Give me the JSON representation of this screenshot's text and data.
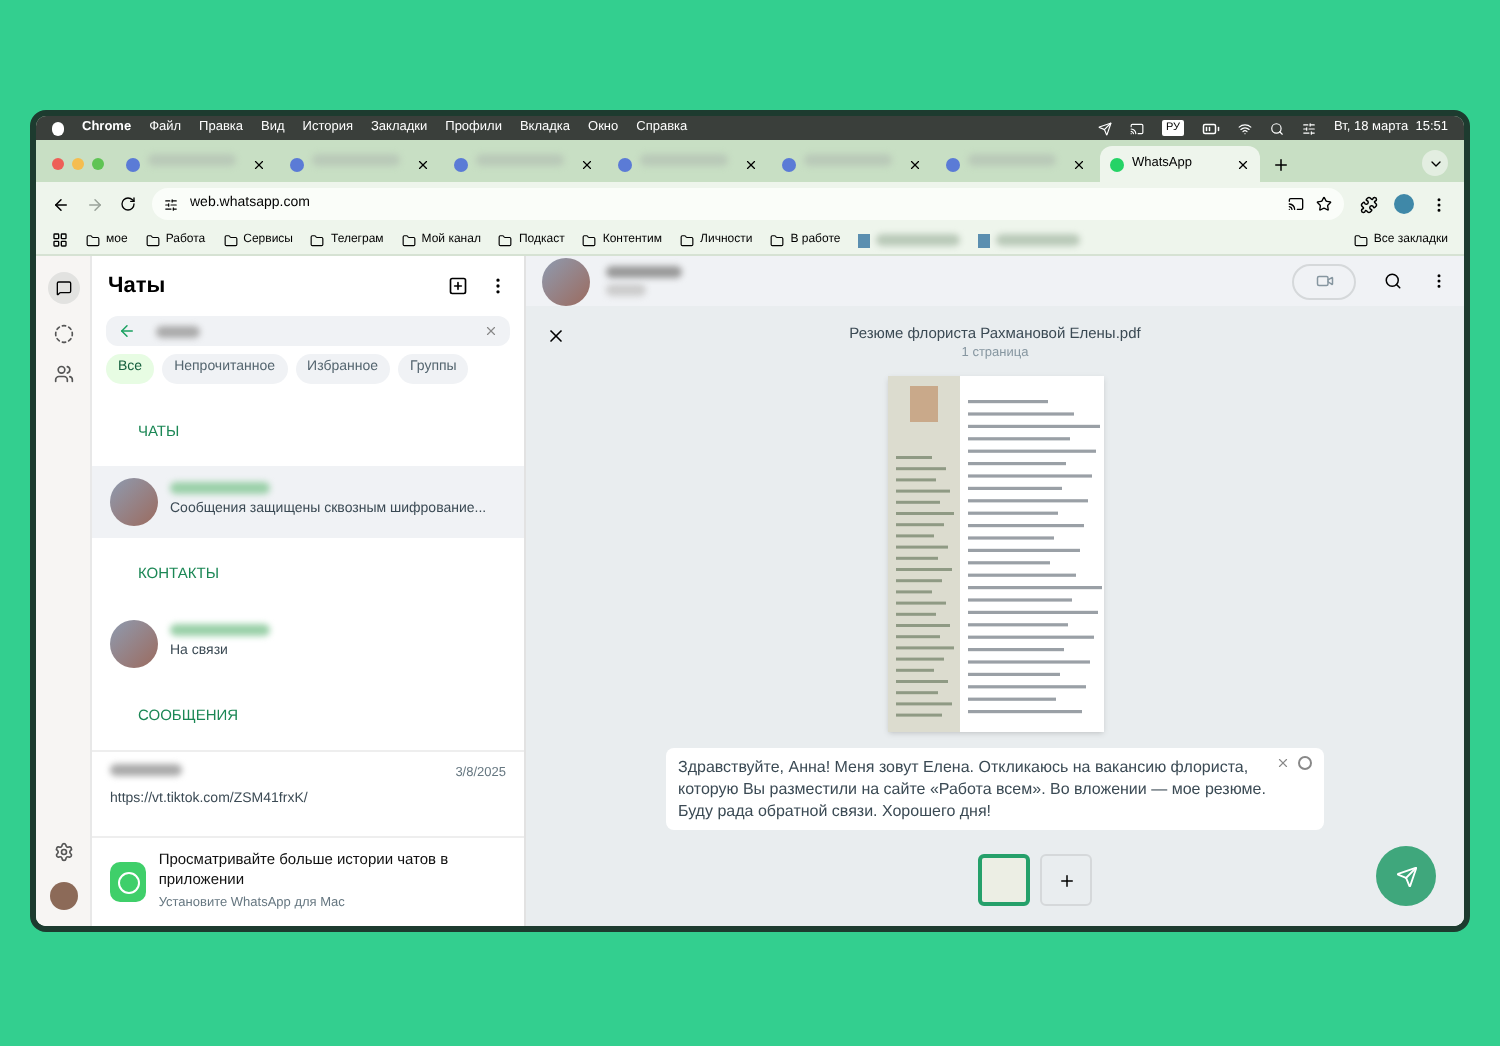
{
  "menu_bar": {
    "app": "Chrome",
    "items": [
      "Файл",
      "Правка",
      "Вид",
      "История",
      "Закладки",
      "Профили",
      "Вкладка",
      "Окно",
      "Справка"
    ],
    "input_source": "РУ",
    "clock": "Вт, 18 марта  15:51"
  },
  "tabs": [
    {
      "kind": "blurred",
      "selected": false
    },
    {
      "kind": "blurred",
      "selected": false
    },
    {
      "kind": "blurred",
      "selected": false
    },
    {
      "kind": "blurred",
      "selected": false
    },
    {
      "kind": "blurred",
      "selected": false
    },
    {
      "kind": "blurred",
      "selected": false
    },
    {
      "kind": "titled",
      "title": "WhatsApp",
      "selected": true
    }
  ],
  "address_bar": {
    "url": "web.whatsapp.com"
  },
  "bookmarks": [
    {
      "kind": "folder",
      "label": "мое"
    },
    {
      "kind": "folder",
      "label": "Работа"
    },
    {
      "kind": "folder",
      "label": "Сервисы"
    },
    {
      "kind": "folder",
      "label": "Телеграм"
    },
    {
      "kind": "folder",
      "label": "Мой канал"
    },
    {
      "kind": "folder",
      "label": "Подкаст"
    },
    {
      "kind": "folder",
      "label": "Контентим"
    },
    {
      "kind": "folder",
      "label": "Личности"
    },
    {
      "kind": "folder",
      "label": "В работе"
    },
    {
      "kind": "blurred"
    },
    {
      "kind": "blurred"
    }
  ],
  "all_bookmarks": "Все закладки",
  "sidebar": {
    "title": "Чаты",
    "filters": [
      {
        "label": "Все",
        "selected": true
      },
      {
        "label": "Непрочитанное",
        "selected": false
      },
      {
        "label": "Избранное",
        "selected": false
      },
      {
        "label": "Группы",
        "selected": false
      }
    ],
    "sections": [
      {
        "title": "ЧАТЫ",
        "items": [
          {
            "preview": "Сообщения защищены сквозным шифрование...",
            "selected": true
          }
        ]
      },
      {
        "title": "КОНТАКТЫ",
        "items": [
          {
            "preview": "На связи",
            "selected": false
          }
        ]
      },
      {
        "title": "СООБЩЕНИЯ",
        "items": [
          {
            "preview": "https://vt.tiktok.com/ZSM41frxK/",
            "date": "3/8/2025",
            "selected": false
          }
        ]
      }
    ],
    "promo": {
      "title": "Просматривайте больше истории чатов в приложении",
      "subtitle": "Установите WhatsApp для Mac"
    }
  },
  "preview": {
    "file_name": "Резюме флориста Рахмановой Елены.pdf",
    "pages": "1 страница",
    "caption": "Здравствуйте, Анна! Меня зовут Елена. Откликаюсь на вакансию флориста, которую Вы разместили на сайте «Работа всем». Во вложении — мое резюме. Буду рада обратной связи. Хорошего дня!"
  }
}
